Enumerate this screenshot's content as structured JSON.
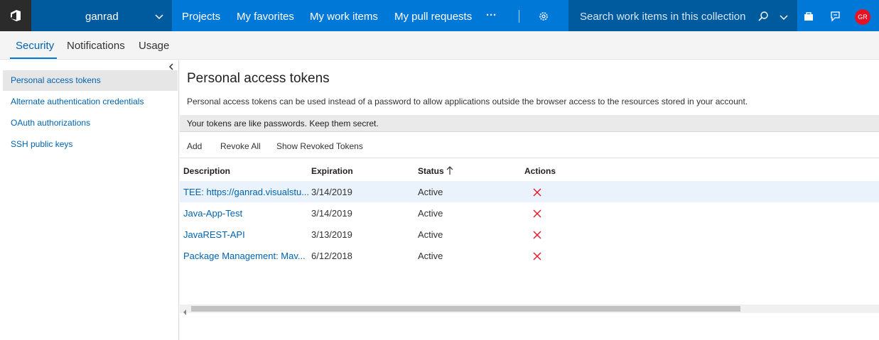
{
  "account": {
    "name": "ganrad"
  },
  "nav": {
    "items": [
      "Projects",
      "My favorites",
      "My work items",
      "My pull requests"
    ],
    "more": "···"
  },
  "search": {
    "placeholder": "Search work items in this collection"
  },
  "user": {
    "initials": "GR",
    "avatar_color": "#e81123"
  },
  "tabs": [
    "Security",
    "Notifications",
    "Usage"
  ],
  "sidebar": {
    "items": [
      "Personal access tokens",
      "Alternate authentication credentials",
      "OAuth authorizations",
      "SSH public keys"
    ]
  },
  "page": {
    "title": "Personal access tokens",
    "description": "Personal access tokens can be used instead of a password to allow applications outside the browser access to the resources stored in your account.",
    "banner": "Your tokens are like passwords. Keep them secret."
  },
  "toolbar": {
    "add": "Add",
    "revoke_all": "Revoke All",
    "show_revoked": "Show Revoked Tokens"
  },
  "table": {
    "headers": [
      "Description",
      "Expiration",
      "Status",
      "Actions"
    ],
    "rows": [
      {
        "description": "TEE: https://ganrad.visualstu...",
        "expiration": "3/14/2019",
        "status": "Active"
      },
      {
        "description": "Java-App-Test",
        "expiration": "3/14/2019",
        "status": "Active"
      },
      {
        "description": "JavaREST-API",
        "expiration": "3/13/2019",
        "status": "Active"
      },
      {
        "description": "Package Management: Mav...",
        "expiration": "6/12/2018",
        "status": "Active"
      }
    ]
  },
  "colors": {
    "brand": "#0078d7",
    "brand_dark": "#005a9e",
    "link": "#0063b1",
    "revoke": "#e81123"
  }
}
